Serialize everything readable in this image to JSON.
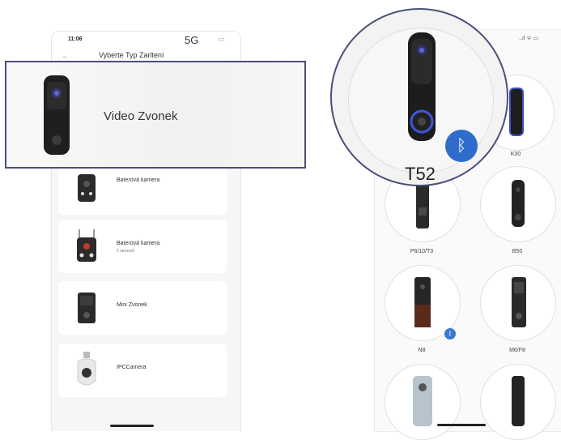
{
  "left_phone": {
    "time": "11:06",
    "network": "5G",
    "header_title": "Vyberte Typ Zarltení",
    "items": [
      {
        "label": "Baterová kamera",
        "sub": ""
      },
      {
        "label": "Baterová kamera",
        "sub": "5 senzorů"
      },
      {
        "label": "Mini Zvonek",
        "sub": ""
      },
      {
        "label": "IPCCamera",
        "sub": ""
      }
    ]
  },
  "highlight": {
    "label": "Video Zvonek"
  },
  "zoom": {
    "label": "T52"
  },
  "right_phone": {
    "status": "..ıl ᯤ ▭",
    "devices": [
      "K30",
      "P6/10/T3",
      "B50",
      "N8",
      "M6/F8"
    ]
  },
  "icons": {
    "bluetooth": "bluetooth-icon",
    "back": "back-arrow-icon"
  },
  "colors": {
    "accent": "#2f6ccc",
    "highlight_border": "#4a4f7a"
  }
}
